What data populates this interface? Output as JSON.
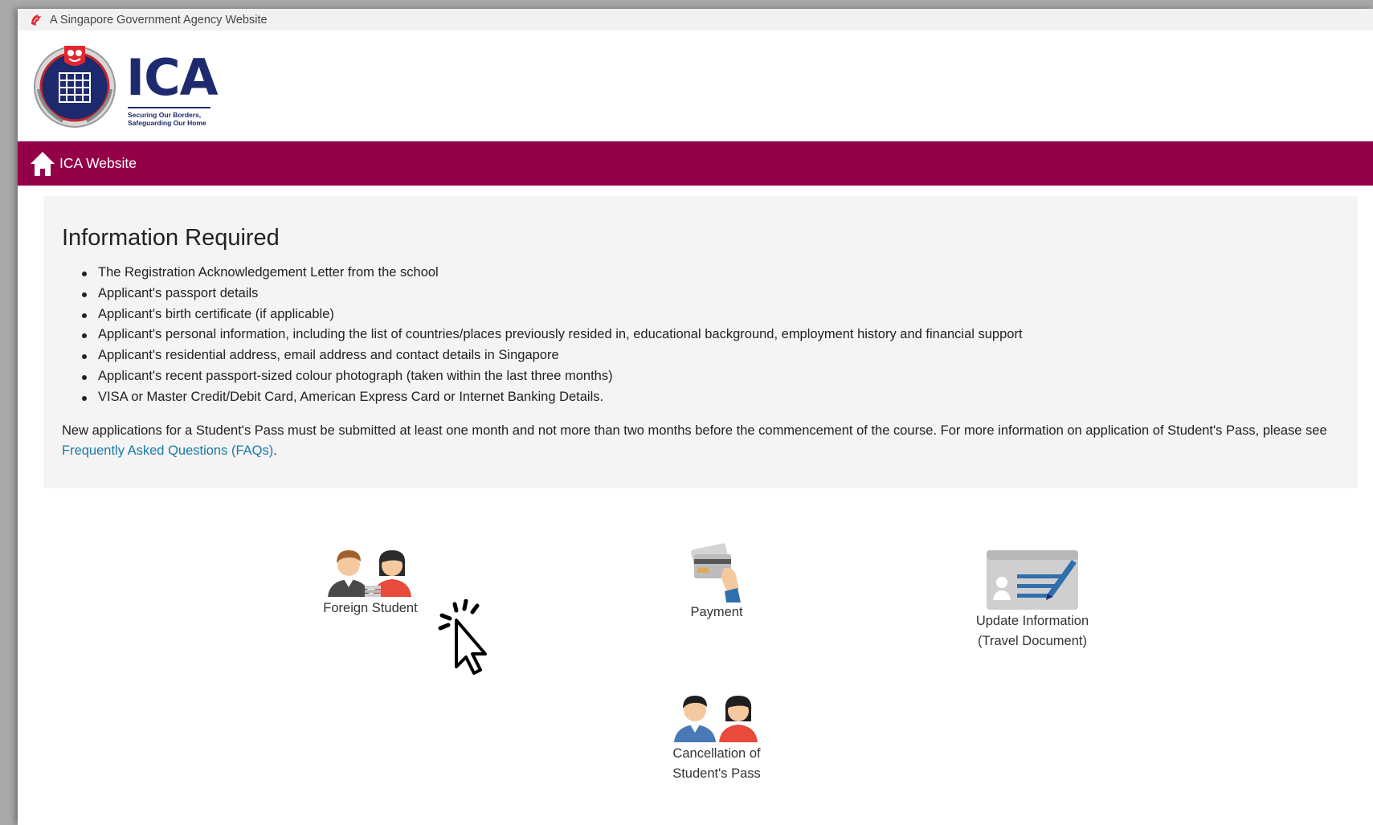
{
  "gov_bar": {
    "text": "A Singapore Government Agency Website"
  },
  "header": {
    "logo_word": "ICA",
    "logo_tagline_1": "Securing Our Borders,",
    "logo_tagline_2": "Safeguarding Our Home"
  },
  "nav": {
    "home_label": "ICA Website"
  },
  "info": {
    "title": "Information Required",
    "items": [
      "The Registration Acknowledgement Letter from the school",
      "Applicant's passport details",
      "Applicant's birth certificate (if applicable)",
      "Applicant's personal information, including the list of countries/places previously resided in, educational background, employment history and financial support",
      "Applicant's residential address, email address and contact details in Singapore",
      "Applicant's recent passport-sized colour photograph (taken within the last three months)",
      "VISA or Master Credit/Debit Card, American Express Card or Internet Banking Details."
    ],
    "note_text": "New applications for a Student's Pass must be submitted at least one month and not more than two months before the commencement of the course. For more information on application of Student's Pass, please see ",
    "note_link": "Frequently Asked Questions (FAQs)",
    "note_end": "."
  },
  "tiles": {
    "foreign_student": "Foreign Student",
    "payment": "Payment",
    "update_info_1": "Update Information",
    "update_info_2": "(Travel Document)",
    "cancellation_1": "Cancellation of",
    "cancellation_2": "Student's Pass"
  },
  "colors": {
    "nav_bg": "#940047",
    "link": "#1b7aa6",
    "logo_navy": "#1e2a6e",
    "singapore_red": "#e3262f"
  }
}
